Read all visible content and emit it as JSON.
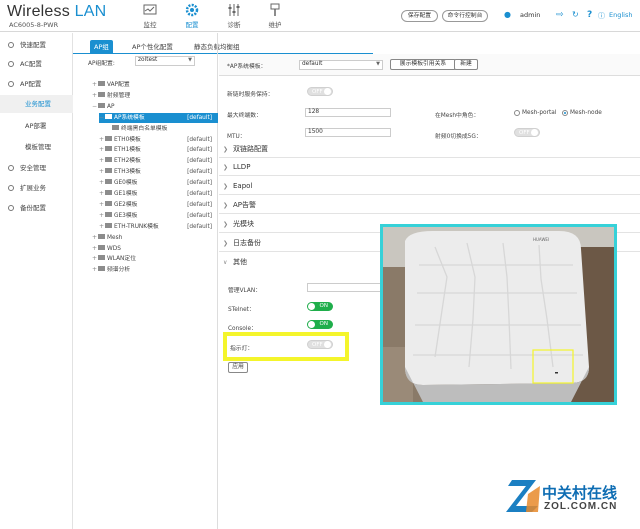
{
  "header": {
    "brand_main": "Wireless",
    "brand_accent": "LAN",
    "model": "AC6005-8-PWR",
    "nav": [
      {
        "label": "监控"
      },
      {
        "label": "配置"
      },
      {
        "label": "诊断"
      },
      {
        "label": "维护"
      }
    ],
    "save_config": "保存配置",
    "command_line": "命令行控制台",
    "user": "admin",
    "language": "English"
  },
  "sidebar": {
    "items": [
      {
        "label": "快速配置"
      },
      {
        "label": "AC配置"
      },
      {
        "label": "AP配置"
      },
      {
        "label": "业务配置"
      },
      {
        "label": "AP部署"
      },
      {
        "label": "模板管理"
      },
      {
        "label": "安全管理"
      },
      {
        "label": "扩展业务"
      },
      {
        "label": "备份配置"
      }
    ]
  },
  "tabs": [
    {
      "label": "AP组"
    },
    {
      "label": "AP个性化配置"
    },
    {
      "label": "静态负载均衡组"
    }
  ],
  "tree": {
    "group_label": "AP组配置:",
    "group_value": "zoltest",
    "rows": [
      {
        "label": "VAP配置",
        "def": ""
      },
      {
        "label": "射频管理",
        "def": ""
      },
      {
        "label": "AP",
        "def": ""
      },
      {
        "label": "AP系统模板",
        "def": "[default]"
      },
      {
        "label": "终端黑白名单模板",
        "def": ""
      },
      {
        "label": "ETH0模板",
        "def": "[default]"
      },
      {
        "label": "ETH1模板",
        "def": "[default]"
      },
      {
        "label": "ETH2模板",
        "def": "[default]"
      },
      {
        "label": "ETH3模板",
        "def": "[default]"
      },
      {
        "label": "GE0模板",
        "def": "[default]"
      },
      {
        "label": "GE1模板",
        "def": "[default]"
      },
      {
        "label": "GE2模板",
        "def": "[default]"
      },
      {
        "label": "GE3模板",
        "def": "[default]"
      },
      {
        "label": "ETH-TRUNK模板",
        "def": "[default]"
      },
      {
        "label": "Mesh",
        "def": ""
      },
      {
        "label": "WDS",
        "def": ""
      },
      {
        "label": "WLAN定位",
        "def": ""
      },
      {
        "label": "频谱分析",
        "def": ""
      }
    ]
  },
  "form": {
    "template_label": "*AP系统模板：",
    "template_value": "default",
    "show_ref": "展示模板引用关系",
    "new_btn": "新建",
    "keepalive_label": "新链时服务保持：",
    "keepalive": "OFF",
    "max_users_label": "最大终端数：",
    "max_users": "128",
    "mesh_role_label": "在Mesh中角色：",
    "mesh_portal": "Mesh-portal",
    "mesh_node": "Mesh-node",
    "mtu_label": "MTU：",
    "mtu": "1500",
    "radio5g_label": "射频0切换成5G：",
    "radio5g": "OFF",
    "sections": [
      "双链路配置",
      "LLDP",
      "Eapol",
      "AP告警",
      "光模块",
      "日志备份",
      "其他"
    ],
    "mgmt_vlan_label": "管理VLAN：",
    "stelnet_label": "STelnet：",
    "stelnet": "ON",
    "console_label": "Console：",
    "console": "ON",
    "led_label": "指示灯：",
    "led": "OFF",
    "apply": "应用"
  },
  "watermark": {
    "name": "中关村在线",
    "url": "ZOL.COM.CN"
  },
  "device_brand": "HUAWEI"
}
